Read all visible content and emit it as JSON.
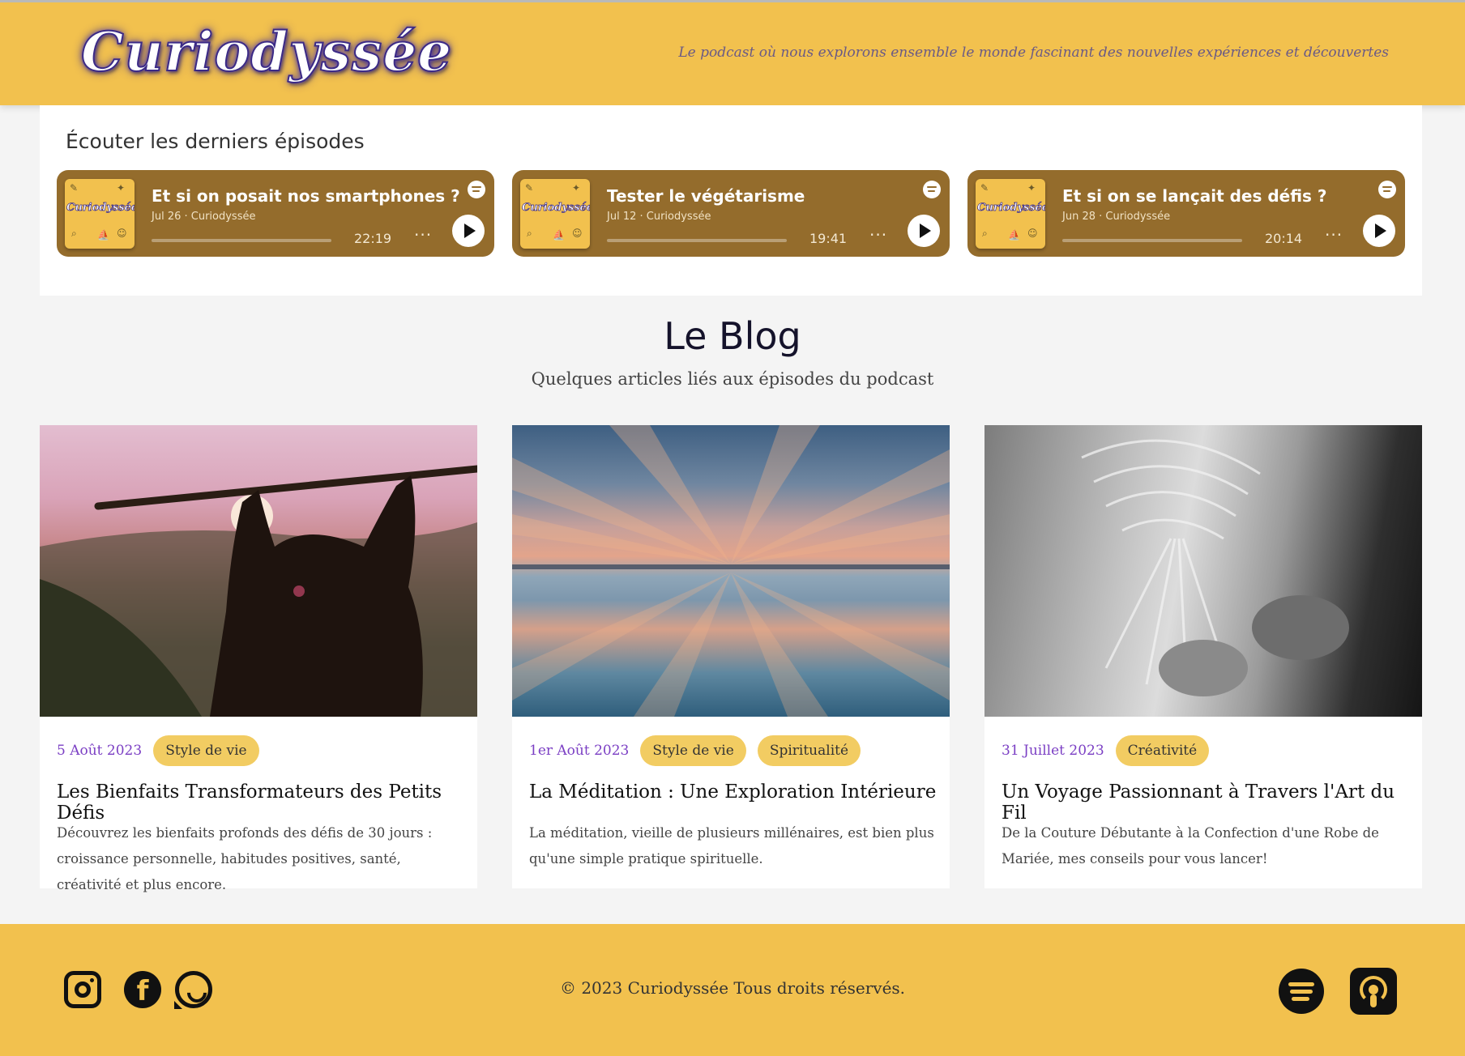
{
  "header": {
    "logo": "Curiodyssée",
    "tagline": "Le podcast où nous explorons ensemble le monde fascinant des nouvelles expériences et découvertes"
  },
  "episodes": {
    "title": "Écouter les derniers épisodes",
    "items": [
      {
        "title": "Et si on posait nos smartphones ?",
        "meta": "Jul 26 · Curiodyssée",
        "duration": "22:19",
        "more": "···",
        "thumb_word": "Curiodyssée"
      },
      {
        "title": "Tester le végétarisme",
        "meta": "Jul 12 · Curiodyssée",
        "duration": "19:41",
        "more": "···",
        "thumb_word": "Curiodyssée"
      },
      {
        "title": "Et si on se lançait des défis ?",
        "meta": "Jun 28 · Curiodyssée",
        "duration": "20:14",
        "more": "···",
        "thumb_word": "Curiodyssée"
      }
    ]
  },
  "blog": {
    "title": "Le Blog",
    "subtitle": "Quelques articles liés aux épisodes du podcast",
    "posts": [
      {
        "date": "5 Août 2023",
        "tags": [
          "Style de vie"
        ],
        "title": "Les Bienfaits Transformateurs des Petits Défis",
        "excerpt": "Découvrez les bienfaits profonds des défis de 30 jours : croissance personnelle, habitudes positives, santé, créativité et plus encore."
      },
      {
        "date": "1er Août 2023",
        "tags": [
          "Style de vie",
          "Spiritualité"
        ],
        "title": "La Méditation : Une Exploration Intérieure",
        "excerpt": "La méditation, vieille de plusieurs millénaires, est bien plus qu'une simple pratique spirituelle."
      },
      {
        "date": "31 Juillet 2023",
        "tags": [
          "Créativité"
        ],
        "title": "Un Voyage Passionnant à Travers l'Art du Fil",
        "excerpt": "De la Couture Débutante à la Confection d'une Robe de Mariée, mes conseils pour vous lancer!"
      }
    ]
  },
  "footer": {
    "copyright": "© 2023 Curiodyssée Tous droits réservés.",
    "facebook_glyph": "f",
    "social_icons": [
      "instagram-icon",
      "facebook-icon",
      "whatsapp-icon"
    ],
    "platform_icons": [
      "spotify-icon",
      "apple-podcasts-icon"
    ]
  },
  "colors": {
    "brand_yellow": "#f2c14e",
    "episode_card": "#946c2c",
    "tag_yellow": "#f2cc62",
    "date_purple": "#7b3fc4"
  }
}
